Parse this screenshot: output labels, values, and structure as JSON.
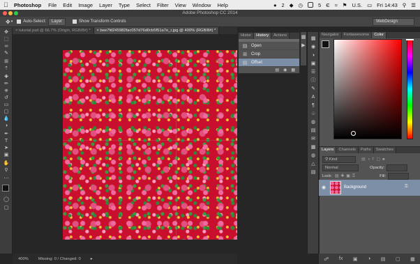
{
  "menubar": {
    "app_name": "Photoshop",
    "items": [
      "File",
      "Edit",
      "Image",
      "Layer",
      "Type",
      "Select",
      "Filter",
      "View",
      "Window",
      "Help"
    ],
    "status": {
      "badge": "2",
      "count": "5",
      "region": "U.S.",
      "clock": "Fri 14:43"
    }
  },
  "window": {
    "title": "Adobe Photoshop CC 2014"
  },
  "options": {
    "auto_select_label": "Auto-Select:",
    "auto_select_value": "Layer",
    "transform_label": "Show Transform Controls",
    "workspace": "WebDesign"
  },
  "documents": {
    "tabs": [
      {
        "label": "tutorial.psd @ 66.7% (Origin, RGB/8#) *"
      },
      {
        "label": "bee7fd245982fac057d76d0cb5f51a7e_r.jpg @ 400% (RGB/8#) *"
      }
    ]
  },
  "status": {
    "zoom": "400%",
    "info": "Missing: 0 / Changed: 0"
  },
  "history": {
    "tabs": [
      "Histor",
      "History",
      "Actions"
    ],
    "rows": [
      {
        "label": "Open",
        "icon": "document-icon"
      },
      {
        "label": "Crop",
        "icon": "crop-icon"
      },
      {
        "label": "Offset",
        "icon": "document-icon"
      }
    ]
  },
  "color_panel": {
    "tabs": [
      "Navigator",
      "Fontawesome",
      "Color"
    ],
    "hue_color": "#ff0000"
  },
  "layers_panel": {
    "tabs": [
      "Layers",
      "Channels",
      "Paths",
      "Swatches"
    ],
    "filter": "Kind",
    "blend_mode": "Normal",
    "opacity_label": "Opacity:",
    "lock_label": "Lock:",
    "fill_label": "Fill:",
    "layers": [
      {
        "name": "Background"
      }
    ]
  }
}
